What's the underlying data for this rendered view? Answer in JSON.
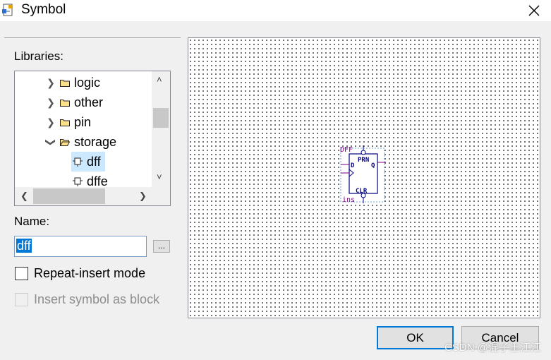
{
  "window": {
    "title": "Symbol",
    "close_icon": "close-icon"
  },
  "libraries": {
    "label": "Libraries:",
    "items": [
      {
        "label": "logic",
        "expanded": false,
        "type": "folder"
      },
      {
        "label": "other",
        "expanded": false,
        "type": "folder"
      },
      {
        "label": "pin",
        "expanded": false,
        "type": "folder"
      },
      {
        "label": "storage",
        "expanded": true,
        "type": "folder"
      },
      {
        "label": "dff",
        "type": "symbol",
        "selected": true
      },
      {
        "label": "dffe",
        "type": "symbol",
        "selected": false
      }
    ]
  },
  "name": {
    "label": "Name:",
    "value": "dff",
    "browse_label": "..."
  },
  "options": {
    "repeat_insert": {
      "label": "Repeat-insert mode",
      "checked": false,
      "enabled": true
    },
    "insert_block": {
      "label": "Insert symbol as block",
      "checked": false,
      "enabled": false
    }
  },
  "preview": {
    "symbol_top_label": "DFF",
    "pin_pr": "PRN",
    "pin_d": "D",
    "pin_q": "Q",
    "pin_clr": "CLR",
    "instance": "ins"
  },
  "buttons": {
    "ok": "OK",
    "cancel": "Cancel"
  },
  "watermark": "CSDN @混子王江江",
  "colors": {
    "accent": "#0078d7",
    "symbol_outline": "#000080",
    "pin_label": "#800080"
  }
}
